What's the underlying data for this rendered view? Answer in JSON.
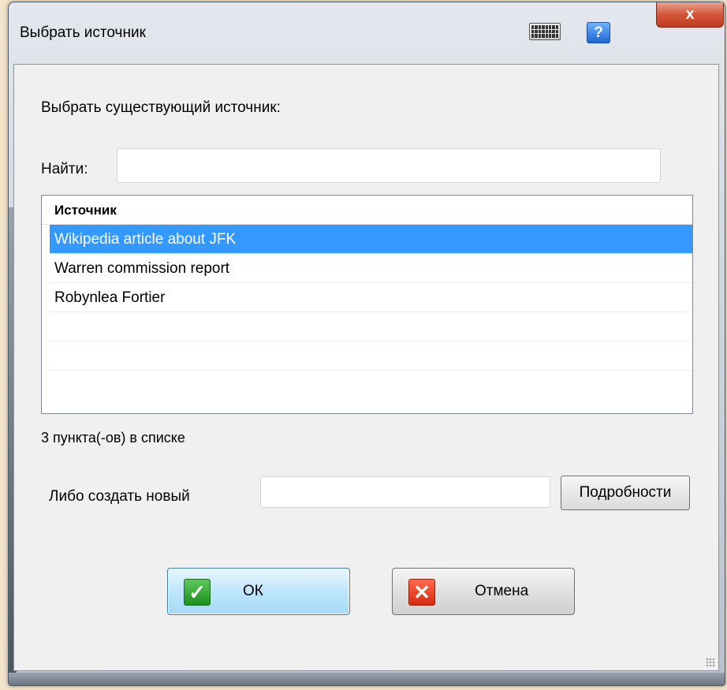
{
  "window": {
    "title": "Выбрать источник",
    "close_label": "x",
    "help_label": "?"
  },
  "main": {
    "heading": "Выбрать существующий источник:",
    "find_label": "Найти:",
    "find_value": "",
    "list": {
      "column_header": "Источник",
      "rows": [
        "Wikipedia article about JFK",
        "Warren commission report",
        "Robynlea Fortier"
      ],
      "selected_index": 0
    },
    "count_text": "3 пункта(-ов) в списке",
    "create_label": "Либо создать новый",
    "create_value": "",
    "details_label": "Подробности",
    "ok_label": "ОК",
    "cancel_label": "Отмена"
  },
  "icons": {
    "keyboard": "keyboard-icon",
    "help": "help-icon",
    "close": "close-icon",
    "ok": "checkmark-icon",
    "cancel": "cross-icon"
  },
  "colors": {
    "selection": "#3399ff",
    "close_button": "#c03b1f",
    "ok_icon": "#1e8f1e",
    "cancel_icon": "#d62b0e"
  }
}
